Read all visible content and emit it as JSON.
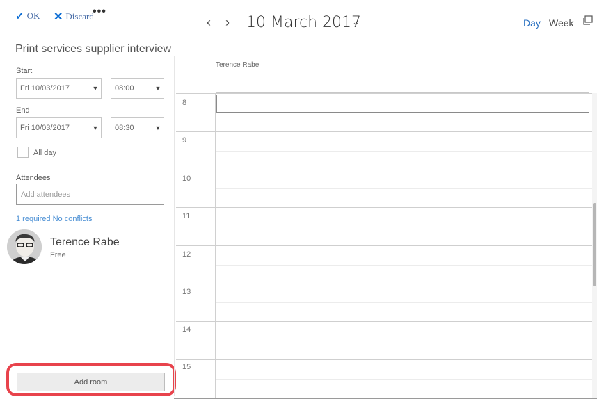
{
  "toolbar": {
    "ok_label": "OK",
    "discard_label": "Discard",
    "more_label": "•••",
    "date_title": "10 March 2017",
    "view_day": "Day",
    "view_week": "Week"
  },
  "form": {
    "title": "Print services supplier interview",
    "start_label": "Start",
    "start_date": "Fri 10/03/2017",
    "start_time": "08:00",
    "end_label": "End",
    "end_date": "Fri 10/03/2017",
    "end_time": "08:30",
    "allday_label": "All day",
    "attendees_label": "Attendees",
    "attendees_placeholder": "Add attendees",
    "conflicts_text": "1 required No conflicts",
    "add_room_label": "Add room"
  },
  "attendee": {
    "name": "Terence Rabe",
    "status": "Free"
  },
  "calendar": {
    "column_header": "Terence Rabe",
    "hours": [
      "8",
      "9",
      "10",
      "11",
      "12",
      "13",
      "14",
      "15"
    ]
  },
  "colors": {
    "accent": "#0a6cd4",
    "highlight": "#e8434c",
    "link": "#4a8fd4"
  }
}
